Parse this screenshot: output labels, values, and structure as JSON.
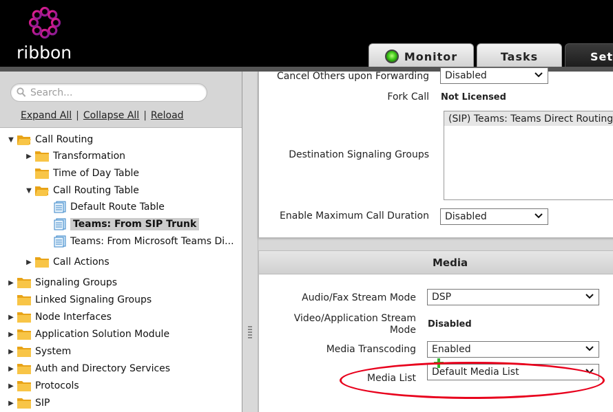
{
  "header": {
    "logo_text": "ribbon",
    "tabs": [
      {
        "label": "Monitor",
        "status_color": "#3fc81a"
      },
      {
        "label": "Tasks"
      },
      {
        "label": "Sett"
      }
    ]
  },
  "sidebar": {
    "search_placeholder": "Search...",
    "links": {
      "expand": "Expand All",
      "collapse": "Collapse All",
      "reload": "Reload",
      "separator": "|"
    },
    "tree": [
      {
        "label": "Call Routing",
        "expanded": true
      },
      {
        "label": "Transformation"
      },
      {
        "label": "Time of Day Table"
      },
      {
        "label": "Call Routing Table",
        "expanded": true
      },
      {
        "label": "Default Route Table"
      },
      {
        "label": "Teams: From SIP Trunk",
        "selected": true
      },
      {
        "label": "Teams: From Microsoft Teams Di..."
      },
      {
        "label": "Call Actions"
      },
      {
        "label": "Signaling Groups"
      },
      {
        "label": "Linked Signaling Groups"
      },
      {
        "label": "Node Interfaces"
      },
      {
        "label": "Application Solution Module"
      },
      {
        "label": "System"
      },
      {
        "label": "Auth and Directory Services"
      },
      {
        "label": "Protocols"
      },
      {
        "label": "SIP"
      }
    ]
  },
  "routing": {
    "cancel_others_label": "Cancel Others upon Forwarding",
    "cancel_others_value": "Disabled",
    "fork_call_label": "Fork Call",
    "fork_call_value": "Not Licensed",
    "dest_groups_label": "Destination Signaling Groups",
    "dest_groups_items": [
      "(SIP) Teams: Teams Direct Routing"
    ],
    "max_duration_label": "Enable Maximum Call Duration",
    "max_duration_value": "Disabled"
  },
  "media": {
    "title": "Media",
    "audio_fax_label": "Audio/Fax Stream Mode",
    "audio_fax_value": "DSP",
    "video_app_label_1": "Video/Application Stream",
    "video_app_label_2": "Mode",
    "video_app_value": "Disabled",
    "transcoding_label": "Media Transcoding",
    "transcoding_value": "Enabled",
    "media_list_label": "Media List",
    "media_list_value": "Default Media List"
  },
  "colors": {
    "highlight": "#e8001c",
    "accent_green": "#3fc81a",
    "logo_magenta": "#d4147a"
  }
}
